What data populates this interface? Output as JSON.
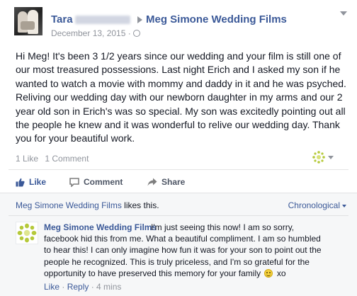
{
  "post": {
    "author_first": "Tara",
    "page_name": "Meg Simone Wedding Films",
    "date": "December 13, 2015 ·",
    "body": "Hi Meg! It's been 3 1/2 years since our wedding and your film is still one of our most treasured possessions. Last night Erich and I asked my son if he wanted to watch a movie with mommy and daddy in it and he was psyched. Reliving our wedding day with our newborn daughter in my arms and our 2 year old son in Erich's was so special. My son was excitedly pointing out all the people he knew and it was wonderful to relive our wedding day. Thank you for your beautiful work.",
    "like_count": "1 Like",
    "comment_count": "1 Comment"
  },
  "actions": {
    "like": "Like",
    "comment": "Comment",
    "share": "Share"
  },
  "likes_line": {
    "page": "Meg Simone Wedding Films",
    "suffix": " likes this."
  },
  "sort": {
    "label": "Chronological"
  },
  "comment": {
    "author": "Meg Simone Wedding Films",
    "text_part1": "I'm just seeing this now! I am so sorry, facebook hid this from me. What a beautiful compliment. I am so humbled to hear this! I can only imagine how fun it was for your son to point out the people he recognized. This is truly priceless, and I'm so grateful for the opportunity to have preserved this memory for your family",
    "text_part2": "xo",
    "like": "Like",
    "sep": " · ",
    "reply": "Reply",
    "time": "4 mins"
  },
  "icons": {
    "globe": "globe-icon",
    "like": "thumbs-up-icon",
    "comment": "speech-bubble-icon",
    "share": "share-arrow-icon",
    "page_logo": "sunburst-logo-icon",
    "emoji": "smile-emoji-icon"
  },
  "colors": {
    "link": "#3b5998",
    "muted": "#90949c",
    "logo": "#b5c93a"
  }
}
